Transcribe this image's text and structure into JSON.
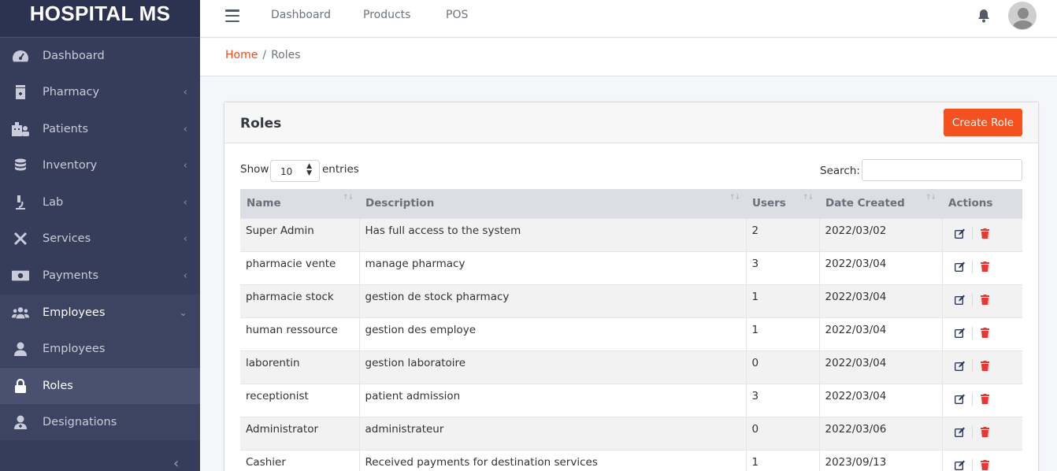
{
  "brand": "HOSPITAL MS",
  "sidebar": {
    "items": [
      {
        "label": "Dashboard",
        "icon": "dashboard-gauge-icon",
        "has_chevron": false
      },
      {
        "label": "Pharmacy",
        "icon": "pharmacy-icon",
        "has_chevron": true
      },
      {
        "label": "Patients",
        "icon": "hospital-building-icon",
        "has_chevron": true
      },
      {
        "label": "Inventory",
        "icon": "database-icon",
        "has_chevron": true
      },
      {
        "label": "Lab",
        "icon": "microscope-icon",
        "has_chevron": true
      },
      {
        "label": "Services",
        "icon": "tools-icon",
        "has_chevron": true
      },
      {
        "label": "Payments",
        "icon": "money-bill-icon",
        "has_chevron": true
      },
      {
        "label": "Employees",
        "icon": "users-icon",
        "has_chevron": true,
        "expanded": true
      },
      {
        "label": "Employees",
        "icon": "user-icon",
        "sub": true
      },
      {
        "label": "Roles",
        "icon": "lock-icon",
        "sub": true,
        "active": true
      },
      {
        "label": "Designations",
        "icon": "user-doctor-icon",
        "sub": true
      }
    ]
  },
  "topbar": {
    "links": [
      "Dashboard",
      "Products",
      "POS"
    ]
  },
  "breadcrumb": {
    "home": "Home",
    "separator": "/",
    "current": "Roles"
  },
  "card": {
    "title": "Roles",
    "create_button": "Create Role"
  },
  "table_controls": {
    "show_label": "Show",
    "page_length": "10",
    "entries_label": "entries",
    "search_label": "Search:",
    "search_value": ""
  },
  "table": {
    "columns": [
      "Name",
      "Description",
      "Users",
      "Date Created",
      "Actions"
    ],
    "rows": [
      {
        "name": "Super Admin",
        "description": "Has full access to the system",
        "users": "2",
        "date": "2022/03/02"
      },
      {
        "name": "pharmacie vente",
        "description": "manage pharmacy",
        "users": "3",
        "date": "2022/03/04"
      },
      {
        "name": "pharmacie stock",
        "description": "gestion de stock pharmacy",
        "users": "1",
        "date": "2022/03/04"
      },
      {
        "name": "human ressource",
        "description": "gestion des employe",
        "users": "1",
        "date": "2022/03/04"
      },
      {
        "name": "laborentin",
        "description": "gestion laboratoire",
        "users": "0",
        "date": "2022/03/04"
      },
      {
        "name": "receptionist",
        "description": "patient admission",
        "users": "3",
        "date": "2022/03/04"
      },
      {
        "name": "Administrator",
        "description": "administrateur",
        "users": "0",
        "date": "2022/03/06"
      },
      {
        "name": "Cashier",
        "description": "Received payments for destination services",
        "users": "1",
        "date": "2023/09/13"
      }
    ]
  },
  "colors": {
    "accent": "#f5501f",
    "sidebar_bg": "#363d5a",
    "delete": "#e53935"
  }
}
